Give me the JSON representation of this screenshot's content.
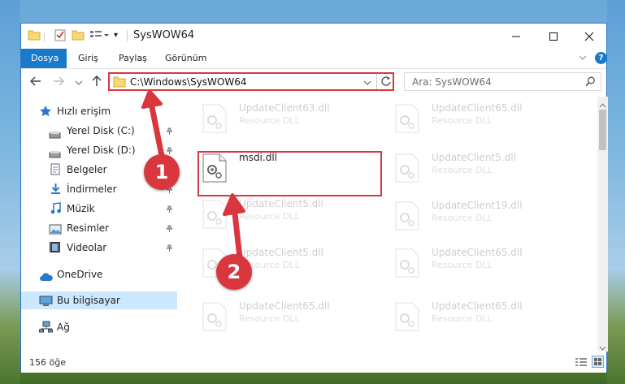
{
  "window": {
    "title": "SysWOW64",
    "minimize": "—",
    "maximize": "☐",
    "close": "✕"
  },
  "ribbon": {
    "tabs": [
      "Dosya",
      "Giriş",
      "Paylaş",
      "Görünüm"
    ],
    "help": "?",
    "expand": "⌄"
  },
  "address": {
    "path": "C:\\Windows\\SysWOW64",
    "refresh": "↻",
    "dropdown": "⌄"
  },
  "search": {
    "placeholder": "Ara: SysWOW64"
  },
  "sidebar": {
    "quick_access": "Hızlı erişim",
    "items": [
      {
        "label": "Yerel Disk (C:)",
        "icon": "drive-icon"
      },
      {
        "label": "Yerel Disk (D:)",
        "icon": "drive-icon"
      },
      {
        "label": "Belgeler",
        "icon": "documents-icon"
      },
      {
        "label": "İndirmeler",
        "icon": "downloads-icon"
      },
      {
        "label": "Müzik",
        "icon": "music-icon"
      },
      {
        "label": "Resimler",
        "icon": "pictures-icon"
      },
      {
        "label": "Videolar",
        "icon": "videos-icon"
      }
    ],
    "onedrive": "OneDrive",
    "this_pc": "Bu bilgisayar",
    "network": "Ağ"
  },
  "files": {
    "highlighted": {
      "name": "msdi.dll"
    },
    "left_column": [
      {
        "name": "UpdateClient63.dll",
        "desc": "Resource DLL"
      },
      {
        "name": "UpdateClient5.dll",
        "desc": "Resource DLL"
      },
      {
        "name": "UpdateClient5.dll",
        "desc": "Resource DLL"
      },
      {
        "name": "UpdateClient65.dll",
        "desc": "Resource DLL"
      }
    ],
    "right_column": [
      {
        "name": "UpdateClient65.dll",
        "desc": "Resource DLL"
      },
      {
        "name": "UpdateClient5.dll",
        "desc": "Resource DLL"
      },
      {
        "name": "UpdateClient19.dll",
        "desc": "Resource DLL"
      },
      {
        "name": "UpdateClient65.dll",
        "desc": "Resource DLL"
      },
      {
        "name": "UpdateClient65.dll",
        "desc": "Resource DLL"
      }
    ]
  },
  "status": {
    "count": "156 öğe"
  },
  "annotations": {
    "step1": "1",
    "step2": "2",
    "color": "#d9363e"
  }
}
